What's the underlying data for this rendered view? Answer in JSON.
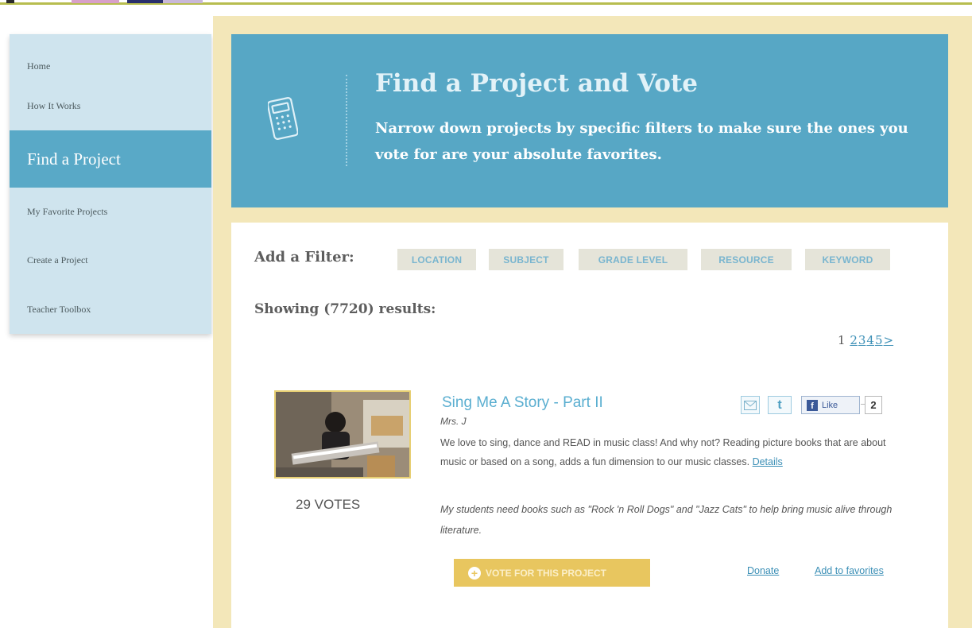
{
  "sidebar": {
    "items": [
      {
        "label": "Home"
      },
      {
        "label": "How It Works"
      },
      {
        "label": "Find a Project"
      },
      {
        "label": "My Favorite Projects"
      },
      {
        "label": "Create a Project"
      },
      {
        "label": "Teacher Toolbox"
      }
    ],
    "active_item": "Find a Project"
  },
  "banner": {
    "title": "Find a Project and Vote",
    "subtitle": "Narrow down projects by specific filters to make sure the ones you vote for are your absolute favorites.",
    "icon": "calculator-icon"
  },
  "filters": {
    "label": "Add a Filter:",
    "buttons": [
      "LOCATION",
      "SUBJECT",
      "GRADE LEVEL",
      "RESOURCE",
      "KEYWORD"
    ]
  },
  "results": {
    "text": "Showing (7720) results:"
  },
  "pagination": {
    "current": "1",
    "pages": [
      "2",
      "3",
      "4",
      "5"
    ],
    "next": ">"
  },
  "project": {
    "title": "Sing Me A Story - Part II",
    "author": "Mrs. J",
    "description": "We love to sing, dance and READ in music class! And why not? Reading picture books that are about music or based on a song, adds a fun dimension to our music classes.",
    "details_link": "Details",
    "need": "My students need books such as \"Rock 'n Roll Dogs\" and \"Jazz Cats\" to help bring music alive through literature.",
    "votes": "29 VOTES",
    "vote_button": "VOTE FOR THIS PROJECT",
    "donate_link": "Donate",
    "favorites_link": "Add to favorites",
    "share": {
      "email_icon": "email-icon",
      "twitter_icon": "twitter-icon",
      "like_label": "Like",
      "like_count": "2"
    }
  },
  "colors": {
    "banner": "#57a7c5",
    "frame": "#f3e7b9",
    "sidebar": "#cfe4ee",
    "sidebar_active": "#59a9c7",
    "link": "#3b8fb6",
    "vote_button": "#e8c65f"
  }
}
